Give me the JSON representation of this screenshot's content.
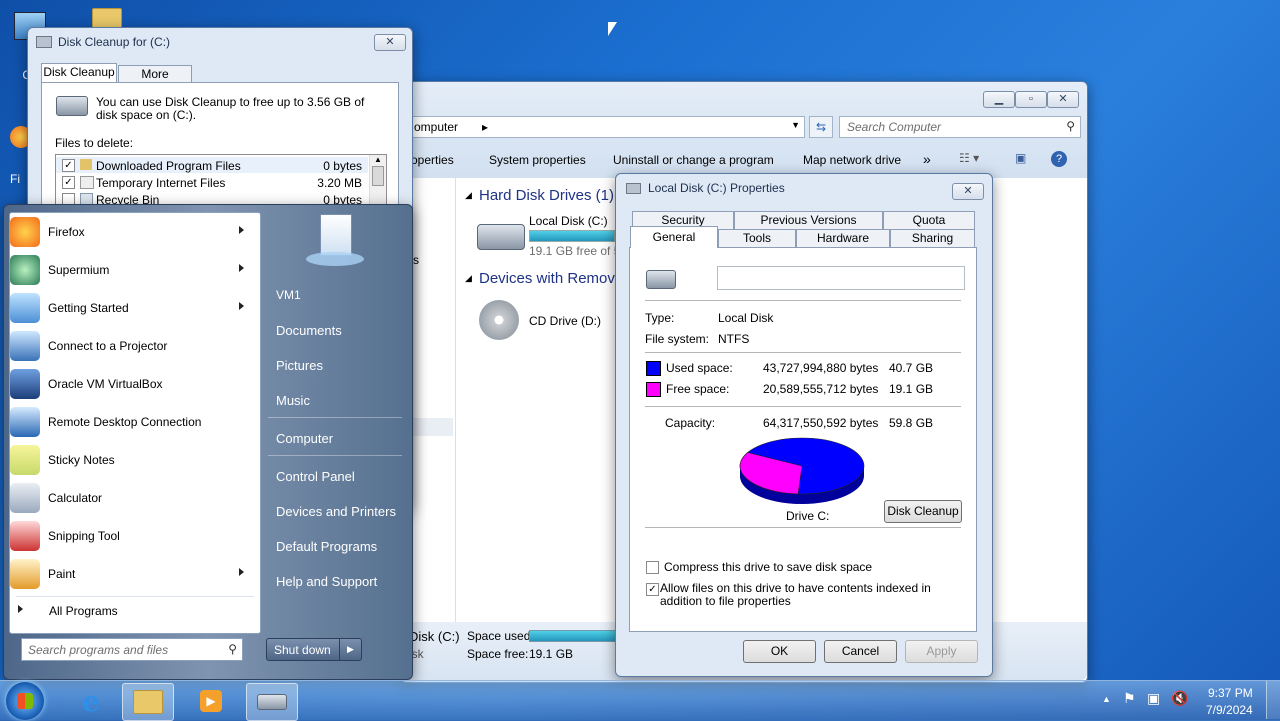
{
  "desktop": {
    "icon1_label": "Co",
    "icon2_label": "Fi"
  },
  "explorer": {
    "breadcrumb": "omputer",
    "search_placeholder": "Search Computer",
    "toolbar": [
      "operties",
      "System properties",
      "Uninstall or change a program",
      "Map network drive"
    ],
    "more": "»",
    "hard_disk_header": "Hard Disk Drives (1)",
    "local_disk_name": "Local Disk (C:)",
    "local_disk_free": "19.1 GB free of 59",
    "devices_header": "Devices with Remova",
    "cd_drive": "CD Drive (D:)",
    "side_text": "s",
    "status": {
      "name": "Disk (C:)",
      "sub": "isk",
      "used_label": "Space used:",
      "free_label": "Space free:",
      "free_value": "19.1 GB"
    }
  },
  "cleanup": {
    "title": "Disk Cleanup for  (C:)",
    "tabs": [
      "Disk Cleanup",
      "More Options"
    ],
    "description": "You can use Disk Cleanup to free up to 3.56 GB of disk space on  (C:).",
    "files_label": "Files to delete:",
    "files": [
      {
        "name": "Downloaded Program Files",
        "size": "0 bytes",
        "checked": "✓"
      },
      {
        "name": "Temporary Internet Files",
        "size": "3.20 MB",
        "checked": "✓"
      },
      {
        "name": "Recycle Bin",
        "size": "0 bytes",
        "checked": ""
      }
    ]
  },
  "props": {
    "title": "Local Disk (C:) Properties",
    "tabs_row1": [
      "Security",
      "Previous Versions",
      "Quota"
    ],
    "tabs_row2": [
      "General",
      "Tools",
      "Hardware",
      "Sharing"
    ],
    "name_value": "",
    "type_label": "Type:",
    "type_value": "Local Disk",
    "fs_label": "File system:",
    "fs_value": "NTFS",
    "used_label": "Used space:",
    "used_bytes": "43,727,994,880 bytes",
    "used_gb": "40.7 GB",
    "free_label": "Free space:",
    "free_bytes": "20,589,555,712 bytes",
    "free_gb": "19.1 GB",
    "cap_label": "Capacity:",
    "cap_bytes": "64,317,550,592 bytes",
    "cap_gb": "59.8 GB",
    "drive_label": "Drive C:",
    "cleanup_button": "Disk Cleanup",
    "compress_label": "Compress this drive to save disk space",
    "index_label": "Allow files on this drive to have contents indexed in addition to file properties",
    "compress_checked": "",
    "index_checked": "✓",
    "ok": "OK",
    "cancel": "Cancel",
    "apply": "Apply",
    "used_fraction": 0.68,
    "colors": {
      "used": "#0000ff",
      "free": "#ff00ff"
    }
  },
  "startmenu": {
    "programs": [
      "Firefox",
      "Supermium",
      "Getting Started",
      "Connect to a Projector",
      "Oracle VM VirtualBox",
      "Remote Desktop Connection",
      "Sticky Notes",
      "Calculator",
      "Snipping Tool",
      "Paint"
    ],
    "all_programs": "All Programs",
    "search_placeholder": "Search programs and files",
    "right": [
      "VM1",
      "Documents",
      "Pictures",
      "Music",
      "Computer",
      "Control Panel",
      "Devices and Printers",
      "Default Programs",
      "Help and Support"
    ],
    "shutdown": "Shut down"
  },
  "taskbar": {
    "time": "9:37 PM",
    "date": "7/9/2024"
  }
}
